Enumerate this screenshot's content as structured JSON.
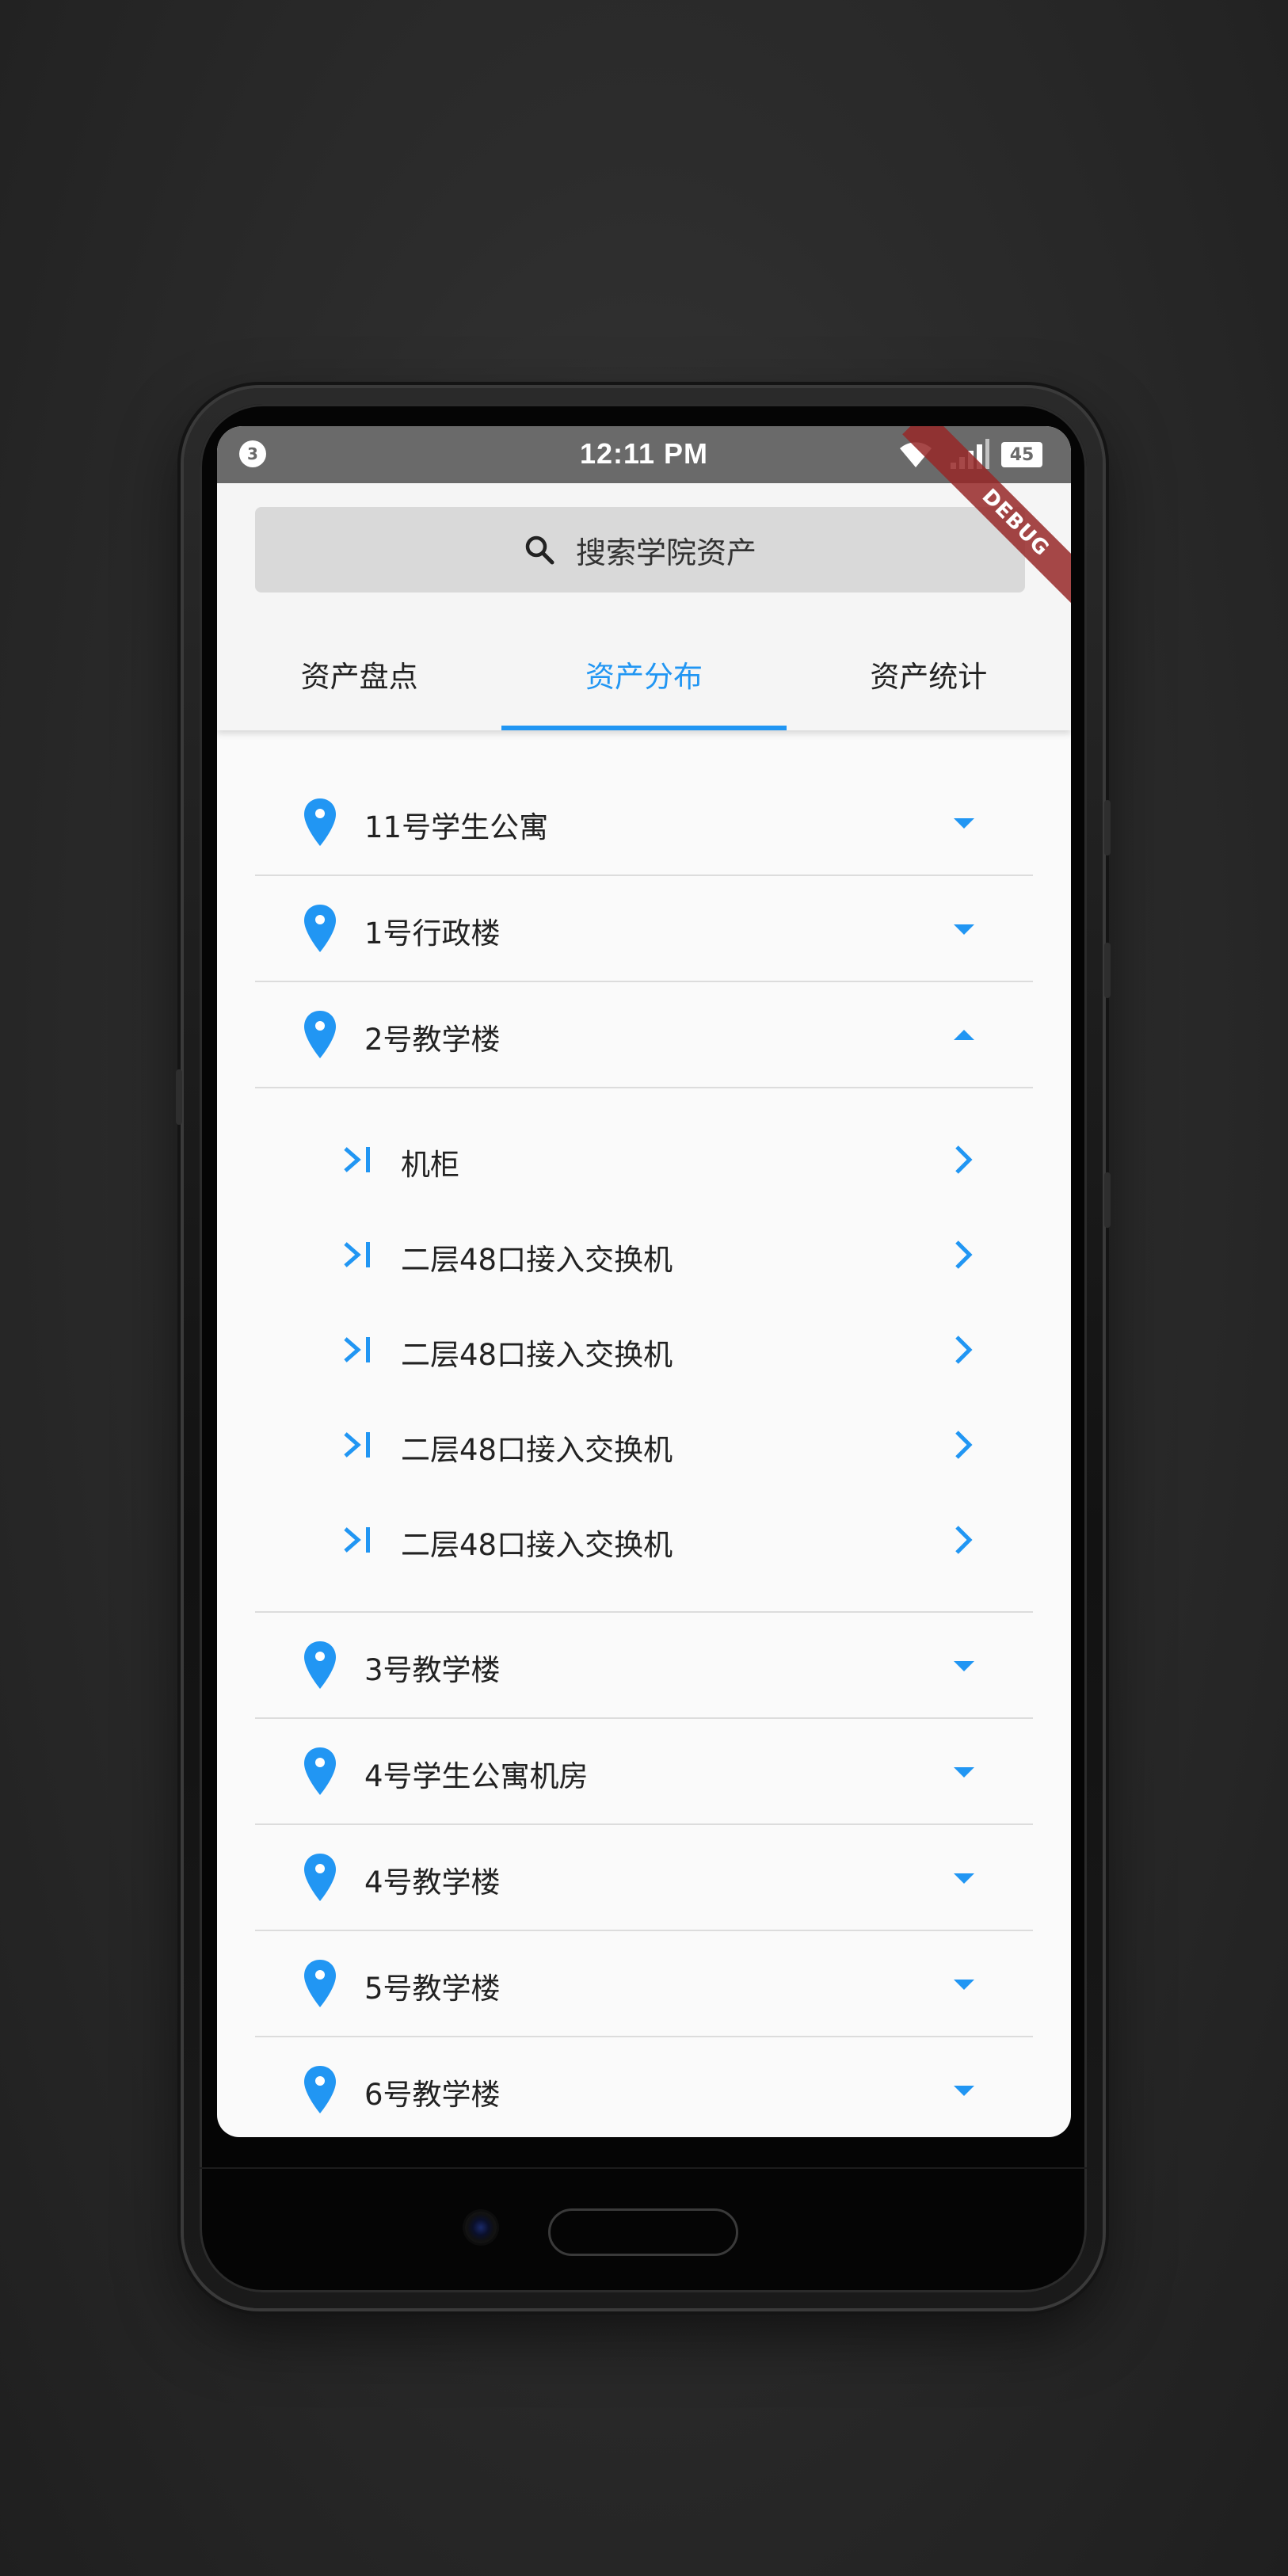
{
  "status_bar": {
    "notification_count": "3",
    "time": "12:11 PM",
    "battery": "45"
  },
  "debug_banner": "DEBUG",
  "search": {
    "placeholder": "搜索学院资产",
    "icon": "search-icon"
  },
  "tabs": [
    {
      "label": "资产盘点",
      "active": false
    },
    {
      "label": "资产分布",
      "active": true
    },
    {
      "label": "资产统计",
      "active": false
    }
  ],
  "locations": [
    {
      "label": "11号学生公寓",
      "expanded": false
    },
    {
      "label": "1号行政楼",
      "expanded": false
    },
    {
      "label": "2号教学楼",
      "expanded": true,
      "children": [
        {
          "label": "机柜"
        },
        {
          "label": "二层48口接入交换机"
        },
        {
          "label": "二层48口接入交换机"
        },
        {
          "label": "二层48口接入交换机"
        },
        {
          "label": "二层48口接入交换机"
        }
      ]
    },
    {
      "label": "3号教学楼",
      "expanded": false
    },
    {
      "label": "4号学生公寓机房",
      "expanded": false
    },
    {
      "label": "4号教学楼",
      "expanded": false
    },
    {
      "label": "5号教学楼",
      "expanded": false
    },
    {
      "label": "6号教学楼",
      "expanded": false
    }
  ],
  "colors": {
    "accent": "#2196f3",
    "status_bar": "#6a6a6a",
    "search_bg": "#d9d9d9",
    "divider": "#dcdcdc",
    "text": "#222222"
  }
}
